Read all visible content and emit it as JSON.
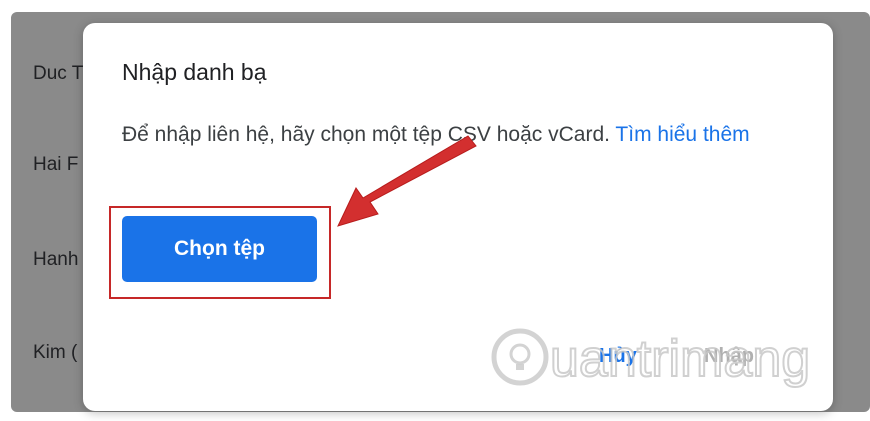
{
  "background_list": {
    "rows": [
      "Duc T",
      "Hai F",
      "Hanh",
      "Kim ("
    ]
  },
  "dialog": {
    "title": "Nhập danh bạ",
    "body_text": "Để nhập liên hệ, hãy chọn một tệp CSV hoặc vCard.",
    "learn_more_link": "Tìm hiểu thêm",
    "choose_file_label": "Chọn tệp",
    "cancel_label": "Hủy",
    "import_label": "Nhập"
  },
  "watermark": {
    "text": "uantrimang"
  },
  "colors": {
    "accent": "#1a73e8",
    "annotation_red": "#d32f2f",
    "backdrop": "#8a8a8a"
  }
}
